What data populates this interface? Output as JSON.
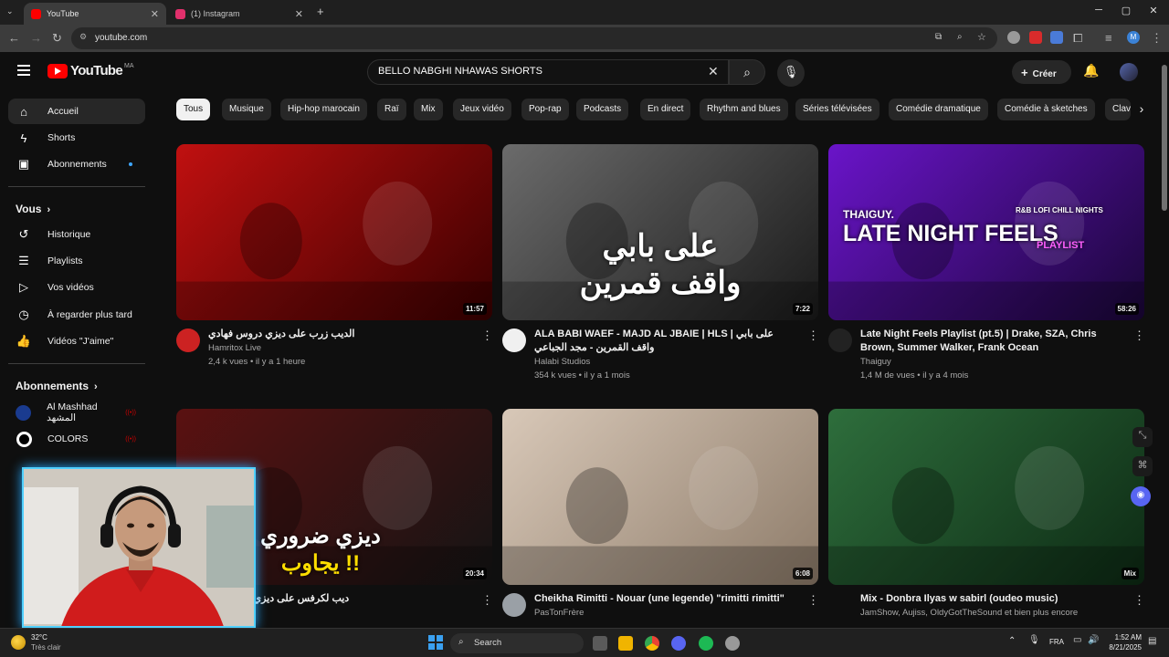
{
  "browser": {
    "tabs": [
      {
        "title": "YouTube",
        "active": true,
        "favicon_color": "#ff0000"
      },
      {
        "title": "(1) Instagram",
        "active": false,
        "favicon_color": "#e1306c"
      }
    ],
    "new_tab": "+",
    "url": "youtube.com",
    "window_controls": [
      "─",
      "▢",
      "✕"
    ]
  },
  "header": {
    "logo": "YouTube",
    "region": "MA",
    "search_value": "BELLO NABGHI NHAWAS SHORTS",
    "create_label": "Créer"
  },
  "sidebar": {
    "main": [
      {
        "label": "Accueil",
        "icon": "home-icon",
        "glyph": "⌂",
        "active": true
      },
      {
        "label": "Shorts",
        "icon": "shorts-icon",
        "glyph": "ϟ"
      },
      {
        "label": "Abonnements",
        "icon": "subscriptions-icon",
        "glyph": "▣",
        "dot": true
      }
    ],
    "you_heading": "Vous",
    "you_items": [
      {
        "label": "Historique",
        "icon": "history-icon",
        "glyph": "↺"
      },
      {
        "label": "Playlists",
        "icon": "playlists-icon",
        "glyph": "☰"
      },
      {
        "label": "Vos vidéos",
        "icon": "your-videos-icon",
        "glyph": "▷"
      },
      {
        "label": "À regarder plus tard",
        "icon": "watch-later-icon",
        "glyph": "◷"
      },
      {
        "label": "Vidéos \"J'aime\"",
        "icon": "liked-icon",
        "glyph": "👍"
      }
    ],
    "subs_heading": "Abonnements",
    "subs": [
      {
        "label": "Al Mashhad المشهد",
        "live": "((•))",
        "avatar_color": "#1a3b8f"
      },
      {
        "label": "COLORS",
        "live": "((•))",
        "avatar_color": "#ffffff"
      }
    ]
  },
  "chips": [
    "Tous",
    "Musique",
    "Hip-hop marocain",
    "Raï",
    "Mix",
    "Jeux vidéo",
    "Pop-rap",
    "Podcasts",
    "En direct",
    "Rhythm and blues",
    "Séries télévisées",
    "Comédie dramatique",
    "Comédie à sketches",
    "Clav"
  ],
  "videos": [
    {
      "title": "الديب زرب على ديزي دروس فهادي",
      "channel": "Hamritox Live",
      "meta": "2,4 k vues • il y a 1 heure",
      "duration": "11:57",
      "thumb_color_a": "#c01010",
      "thumb_color_b": "#3a0000",
      "avatar_color": "#cc2222"
    },
    {
      "title": "ALA BABI WAEF - MAJD AL JBAIE | HLS | على بابي واقف القمرين - مجد الجباعي",
      "channel": "Halabi Studios",
      "meta": "354 k vues • il y a 1 mois",
      "duration": "7:22",
      "thumb_color_a": "#6b6b6b",
      "thumb_color_b": "#1a1a1a",
      "avatar_color": "#f0f0f0",
      "overlay_lines": [
        "على بابي",
        "واقف قمرين"
      ]
    },
    {
      "title": "Late Night Feels Playlist (pt.5) | Drake, SZA, Chris Brown, Summer Walker, Frank Ocean",
      "channel": "Thaiguy",
      "meta": "1,4 M de vues • il y a 4 mois",
      "duration": "58:26",
      "thumb_color_a": "#6a14c9",
      "thumb_color_b": "#1a0638",
      "avatar_color": "#222222",
      "overlay_lines": [
        "THAIGUY.",
        "LATE NIGHT FEELS",
        "R&B LOFI CHILL NIGHTS",
        "PLAYLIST"
      ]
    },
    {
      "title": "ديب لكرفس على ديزي دروس في",
      "channel": "LT EXTRA",
      "meta": "",
      "duration": "20:34",
      "thumb_color_a": "#5a1111",
      "thumb_color_b": "#141414",
      "avatar_color": "#333333",
      "overlay_lines": [
        "ديزي ضروري",
        "يجاوب !!"
      ]
    },
    {
      "title": "Cheikha Rimitti - Nouar (une  legende)  \"rimitti  rimitti\"",
      "channel": "PasTonFrère",
      "meta": "",
      "duration": "6:08",
      "thumb_color_a": "#d8c8b8",
      "thumb_color_b": "#8e7c6a",
      "avatar_color": "#9aa0a6"
    },
    {
      "title": "Mix - Donbra Ilyas w sabirl (oudeo music)",
      "channel": "JamShow, Aujiss, OldyGotTheSound et bien plus encore",
      "meta": "",
      "duration": "Mix",
      "thumb_color_a": "#2e6e3c",
      "thumb_color_b": "#0d2a14"
    }
  ],
  "taskbar": {
    "weather_temp": "32°C",
    "weather_desc": "Très clair",
    "search_label": "Search",
    "lang": "FRA",
    "time": "1:52 AM",
    "date": "8/21/2025"
  }
}
